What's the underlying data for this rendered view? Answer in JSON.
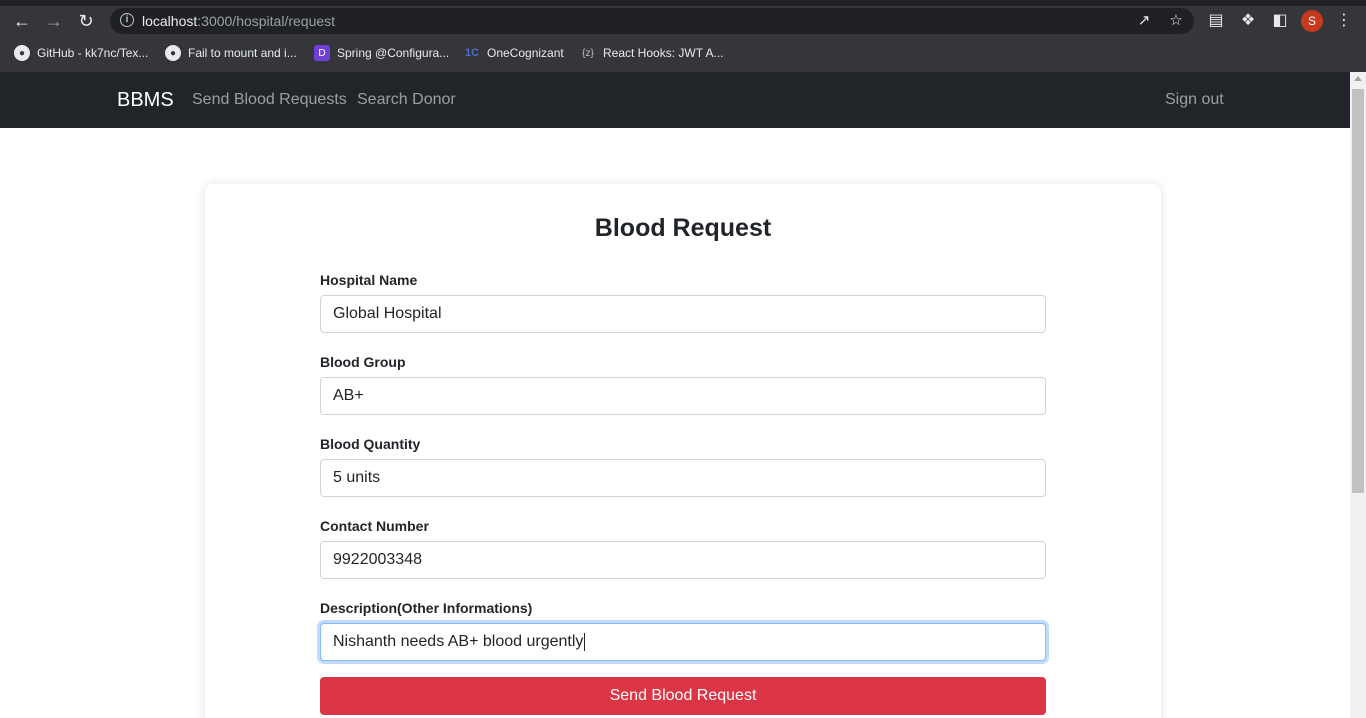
{
  "browser": {
    "url_host": "localhost",
    "url_rest": ":3000/hospital/request",
    "profile_initial": "S",
    "bookmarks": [
      {
        "label": "GitHub - kk7nc/Tex...",
        "icon": "github-icon"
      },
      {
        "label": "Fail to mount and i...",
        "icon": "github-icon"
      },
      {
        "label": "Spring @Configura...",
        "icon": "spring-icon"
      },
      {
        "label": "OneCognizant",
        "icon": "onecognizant-icon"
      },
      {
        "label": "React Hooks: JWT A...",
        "icon": "bracket-z-icon"
      }
    ]
  },
  "navbar": {
    "brand": "BBMS",
    "links": [
      "Send Blood Requests",
      "Search Donor"
    ],
    "signout": "Sign out"
  },
  "form": {
    "title": "Blood Request",
    "fields": [
      {
        "label": "Hospital Name",
        "value": "Global Hospital"
      },
      {
        "label": "Blood Group",
        "value": "AB+"
      },
      {
        "label": "Blood Quantity",
        "value": "5 units"
      },
      {
        "label": "Contact Number",
        "value": "9922003348"
      },
      {
        "label": "Description(Other Informations)",
        "value": "Nishanth needs AB+ blood urgently"
      }
    ],
    "submit_label": "Send Blood Request"
  },
  "colors": {
    "navbar_bg": "#212529",
    "submit_bg": "#dc3545",
    "focus_ring": "#86b7fe"
  }
}
